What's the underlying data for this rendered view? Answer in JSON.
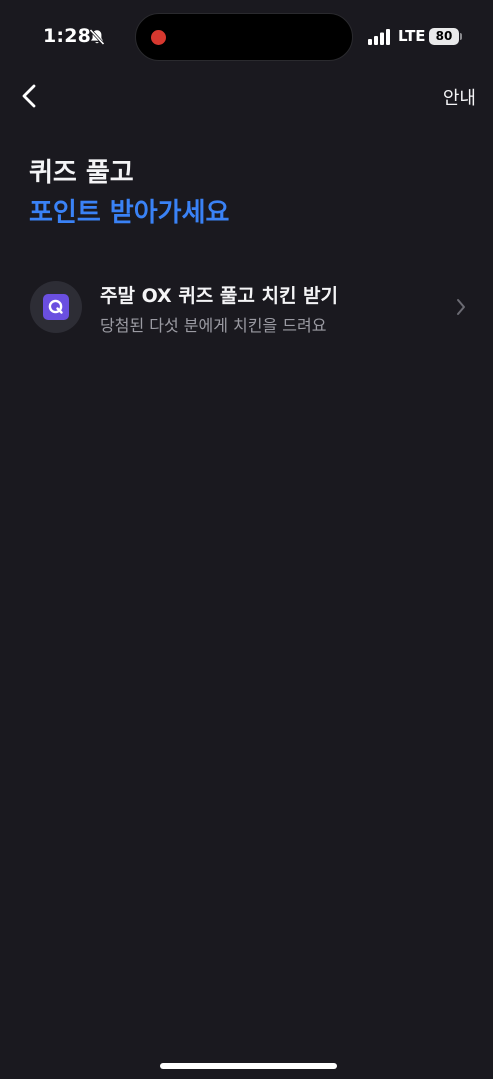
{
  "status_bar": {
    "time": "1:28",
    "network": "LTE",
    "battery": "80",
    "icons": [
      "bell-muted-icon",
      "signal-icon",
      "battery-icon"
    ]
  },
  "nav": {
    "back_icon": "chevron-left-icon",
    "info_label": "안내"
  },
  "headline": {
    "line1": "퀴즈 풀고",
    "line2": "포인트 받아가세요"
  },
  "list": {
    "items": [
      {
        "icon": "quiz-q-icon",
        "title": "주말 OX 퀴즈 풀고 치킨 받기",
        "subtitle": "당첨된 다섯 분에게 치킨을 드려요",
        "trailing_icon": "chevron-right-icon"
      }
    ]
  },
  "colors": {
    "background": "#1a191f",
    "accent_blue": "#3a82f6",
    "quiz_icon_purple": "#6a4fe0",
    "subtitle_gray": "#9b9ba3",
    "recording_dot": "#d7382f"
  }
}
